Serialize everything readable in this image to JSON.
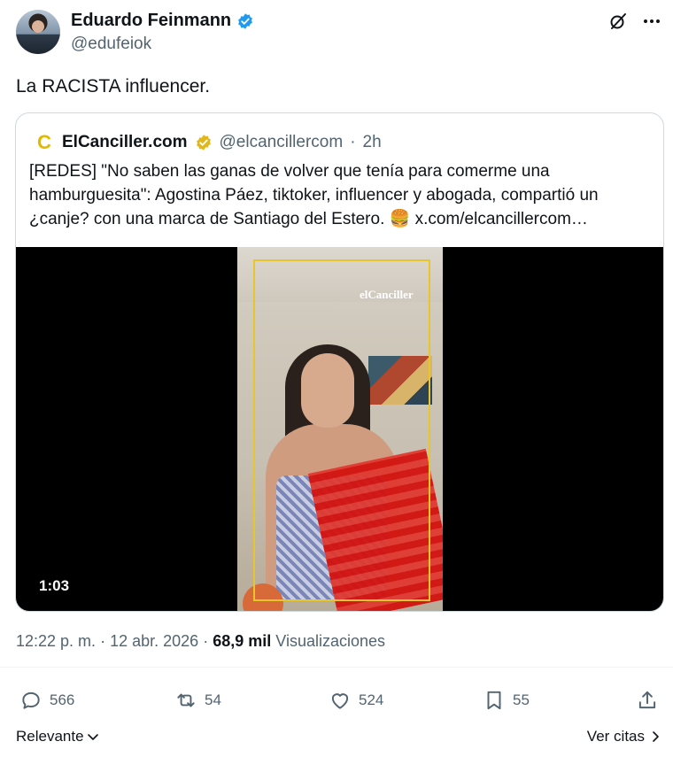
{
  "author": {
    "name": "Eduardo Feinmann",
    "handle": "@edufeiok"
  },
  "tweet": {
    "text": "La RACISTA influencer."
  },
  "quoted": {
    "logo_letter": "C",
    "name": "ElCanciller.com",
    "handle": "@elcancillercom",
    "separator": "·",
    "time": "2h",
    "text_line1": "[REDES] \"No saben las ganas de volver que tenía para comerme una",
    "text_line2": "hamburguesita\": Agostina Páez, tiktoker, influencer y abogada, compartió un",
    "text_line3": "¿canje? con una marca de Santiago del Estero. 🍔",
    "link": "x.com/elcancillercom…",
    "video": {
      "watermark": "elCanciller",
      "duration": "1:03"
    }
  },
  "meta": {
    "time": "12:22 p. m.",
    "sep": "·",
    "date": "12 abr. 2026",
    "sep2": "·",
    "views_count": "68,9 mil",
    "views_label": "Visualizaciones"
  },
  "actions": {
    "replies": "566",
    "reposts": "54",
    "likes": "524",
    "bookmarks": "55"
  },
  "footer": {
    "sort_label": "Relevante",
    "quotes_label": "Ver citas"
  },
  "colors": {
    "verified_blue": "#1d9bf0",
    "verified_gold": "#e2b719",
    "muted": "#536471",
    "text": "#0f1419"
  }
}
